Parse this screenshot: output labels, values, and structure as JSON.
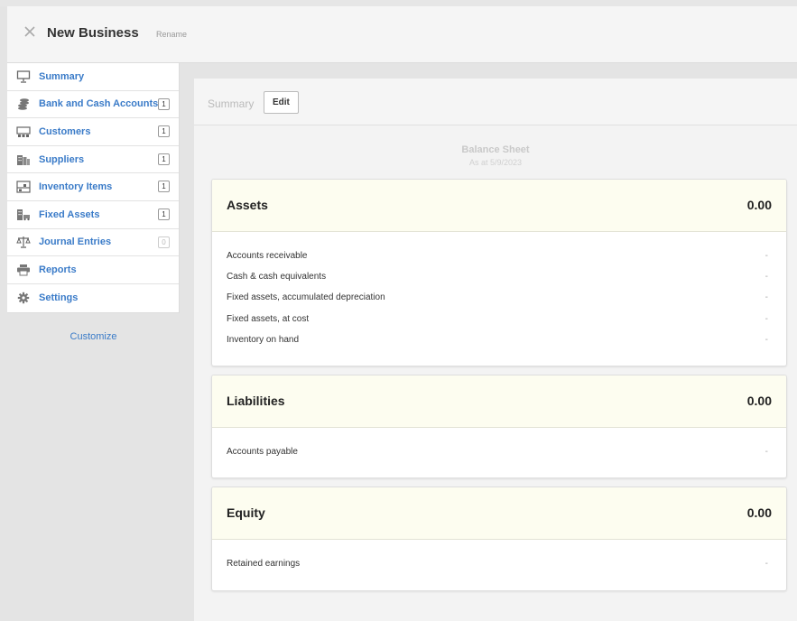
{
  "header": {
    "title": "New Business",
    "rename": "Rename"
  },
  "sidebar": {
    "items": [
      {
        "label": "Summary",
        "icon": "presentation-board-icon",
        "count": null
      },
      {
        "label": "Bank and Cash Accounts",
        "icon": "coins-icon",
        "count": "1"
      },
      {
        "label": "Customers",
        "icon": "customers-icon",
        "count": "1"
      },
      {
        "label": "Suppliers",
        "icon": "buildings-icon",
        "count": "1"
      },
      {
        "label": "Inventory Items",
        "icon": "inventory-icon",
        "count": "1"
      },
      {
        "label": "Fixed Assets",
        "icon": "fixed-assets-icon",
        "count": "1"
      },
      {
        "label": "Journal Entries",
        "icon": "scales-icon",
        "count": "0"
      },
      {
        "label": "Reports",
        "icon": "printer-icon",
        "count": null
      },
      {
        "label": "Settings",
        "icon": "gear-icon",
        "count": null
      }
    ],
    "customize": "Customize"
  },
  "main": {
    "breadcrumb": "Summary",
    "edit_label": "Edit",
    "report_title": "Balance Sheet",
    "report_date": "As at 5/9/2023",
    "sections": [
      {
        "title": "Assets",
        "total": "0.00",
        "rows": [
          {
            "label": "Accounts receivable",
            "value": "-"
          },
          {
            "label": "Cash & cash equivalents",
            "value": "-"
          },
          {
            "label": "Fixed assets, accumulated depreciation",
            "value": "-"
          },
          {
            "label": "Fixed assets, at cost",
            "value": "-"
          },
          {
            "label": "Inventory on hand",
            "value": "-"
          }
        ]
      },
      {
        "title": "Liabilities",
        "total": "0.00",
        "rows": [
          {
            "label": "Accounts payable",
            "value": "-"
          }
        ]
      },
      {
        "title": "Equity",
        "total": "0.00",
        "rows": [
          {
            "label": "Retained earnings",
            "value": "-"
          }
        ]
      }
    ]
  },
  "colors": {
    "link": "#3a7bc8",
    "section_header_bg": "#fdfdf0",
    "sidebar_bg": "#ffffff",
    "page_bg": "#e4e4e4"
  }
}
